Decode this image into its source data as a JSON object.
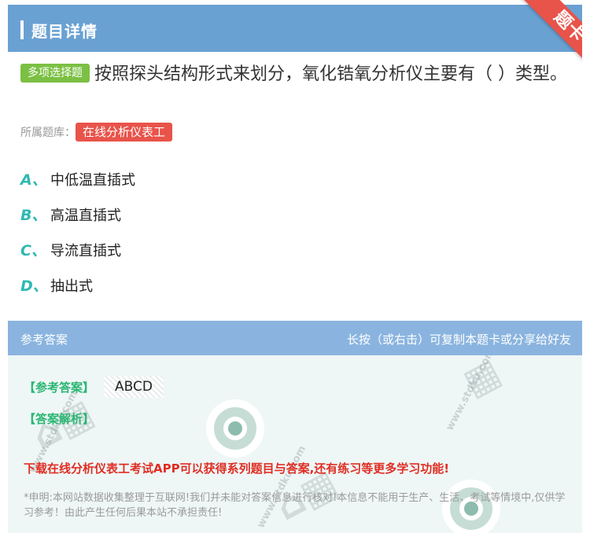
{
  "header": {
    "title": "题目详情"
  },
  "ribbon": {
    "label": "题卡"
  },
  "question": {
    "type_tag": "多项选择题",
    "text": "按照探头结构形式来划分，氧化锆氧分析仪主要有（ ）类型。"
  },
  "bank": {
    "label": "所属题库：",
    "name": "在线分析仪表工"
  },
  "options": [
    {
      "letter": "A、",
      "text": "中低温直插式"
    },
    {
      "letter": "B、",
      "text": "高温直插式"
    },
    {
      "letter": "C、",
      "text": "导流直插式"
    },
    {
      "letter": "D、",
      "text": "抽出式"
    }
  ],
  "answer_section": {
    "title": "参考答案",
    "hint": "长按（或右击）可复制本题卡或分享给好友",
    "answer_label": "【参考答案】",
    "answer_value": "ABCD",
    "analysis_label": "【答案解析】",
    "promo": "下载在线分析仪表工考试APP可以获得系列题目与答案,还有练习等更多学习功能!",
    "disclaimer": "*申明:本网站数据收集整理于互联网!我们并未能对答案信息进行核对!本信息不能用于生产、生活、考试等情境中,仅供学习参考！由此产生任何后果本站不承担责任!"
  },
  "colors": {
    "header_bg": "#6aa1d3",
    "ribbon": "#e8534a",
    "type_tag": "#7bc043",
    "bank_tag": "#e8534a",
    "option_letter": "#2fb9b2",
    "answer_header_bg": "#8ab4df",
    "answer_label": "#2bb673",
    "promo": "#e02e24"
  }
}
